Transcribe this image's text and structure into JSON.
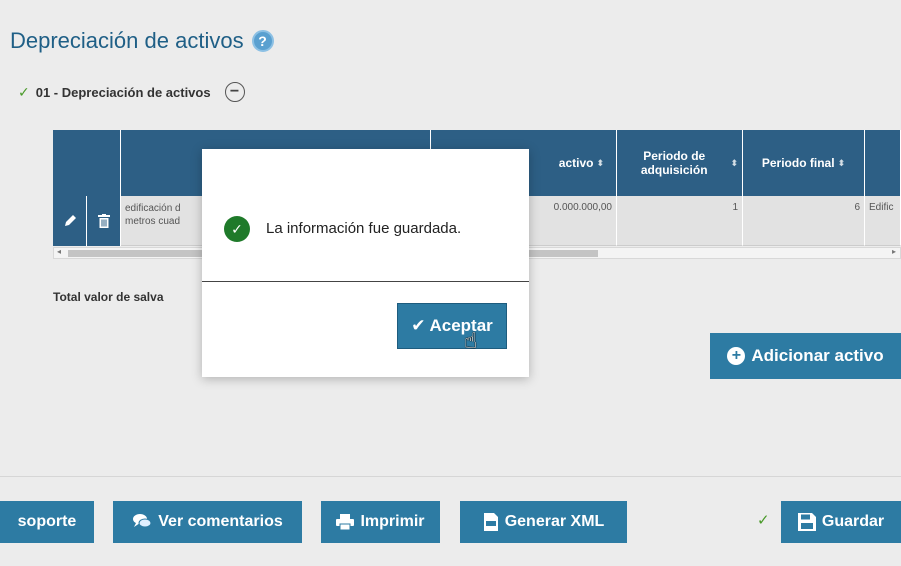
{
  "page": {
    "title": "Depreciación de activos",
    "help_icon": "?"
  },
  "section": {
    "check": "✓",
    "label": "01 - Depreciación de activos",
    "collapse_icon": "−"
  },
  "table": {
    "columns": [
      {
        "label": ""
      },
      {
        "label": ""
      },
      {
        "label": "activo",
        "sort": "⬍"
      },
      {
        "label": "Periodo de adquisición",
        "sort": "⬍"
      },
      {
        "label": "Periodo final",
        "sort": "⬍"
      }
    ],
    "row": {
      "description_line1": "edificación d",
      "description_line2": "metros cuad",
      "value": "0.000.000,00",
      "acq_period": "1",
      "final_period": "6",
      "next_col": "Edific"
    }
  },
  "total": {
    "label": "Total valor de salva"
  },
  "buttons": {
    "add_asset": "Adicionar activo",
    "support": "soporte",
    "comments": "Ver comentarios",
    "print": "Imprimir",
    "xml": "Generar XML",
    "save": "Guardar"
  },
  "dialog": {
    "message": "La información fue guardada.",
    "accept": "Aceptar"
  },
  "icons": {
    "edit": "pencil-icon",
    "delete": "trash-icon",
    "success": "check-circle-icon",
    "hand": "hand-cursor-icon"
  },
  "colors": {
    "primary": "#2d7ba3",
    "header": "#2d5f85",
    "success": "#1f7a2a",
    "title": "#1f5f86"
  }
}
